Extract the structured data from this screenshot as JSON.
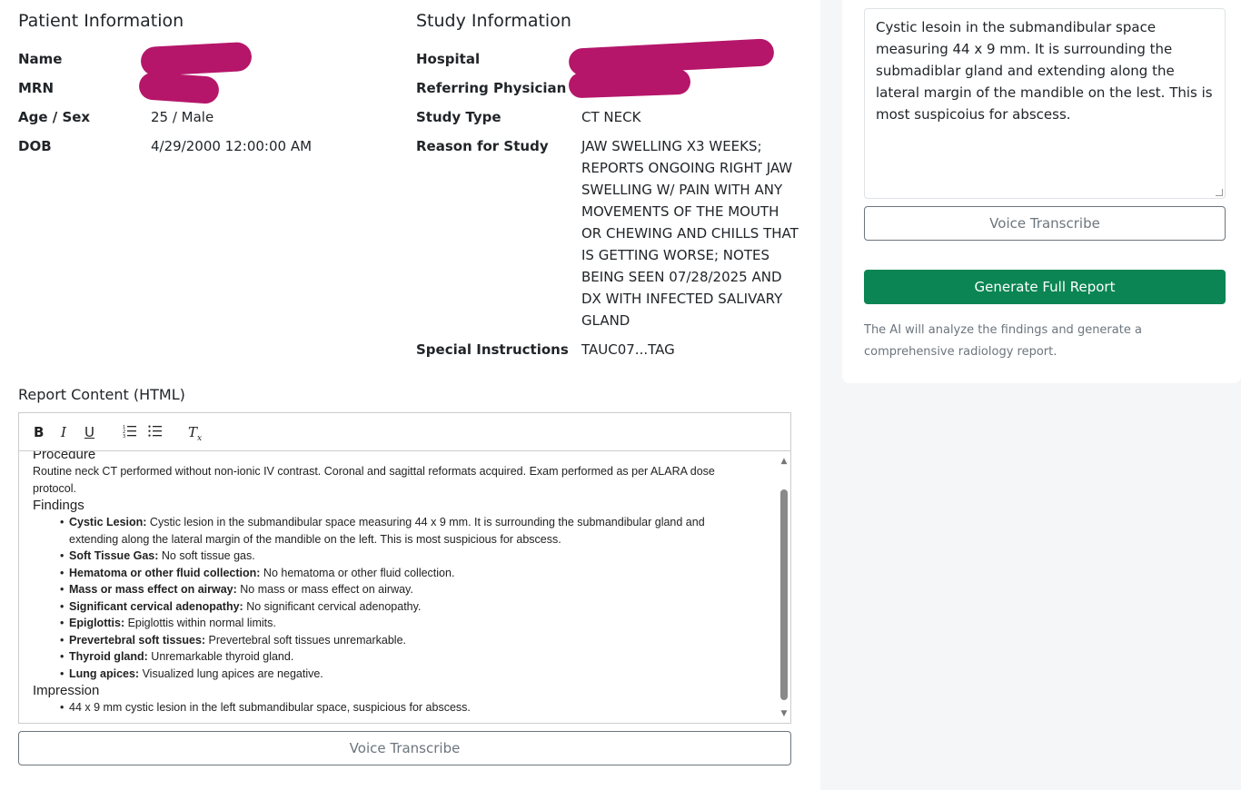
{
  "patient": {
    "title": "Patient Information",
    "name_label": "Name",
    "mrn_label": "MRN",
    "age_sex_label": "Age / Sex",
    "age_sex_value": "25 / Male",
    "dob_label": "DOB",
    "dob_value": "4/29/2000 12:00:00 AM"
  },
  "study": {
    "title": "Study Information",
    "hospital_label": "Hospital",
    "referring_label": "Referring Physician",
    "type_label": "Study Type",
    "type_value": "CT NECK",
    "reason_label": "Reason for Study",
    "reason_lines": [
      "JAW SWELLING X3 WEEKS;",
      "REPORTS ONGOING RIGHT JAW",
      "SWELLING W/ PAIN WITH ANY",
      "MOVEMENTS OF THE MOUTH",
      "OR CHEWING AND CHILLS THAT",
      "IS GETTING WORSE; NOTES",
      "BEING SEEN 07/28/2025 AND",
      "DX WITH INFECTED SALIVARY",
      "GLAND"
    ],
    "special_label": "Special Instructions",
    "special_value": "TAUC07...TAG"
  },
  "report": {
    "label": "Report Content (HTML)",
    "toolbar": {
      "bold": "B",
      "italic": "I",
      "underline": "U",
      "ordered_list": "☰",
      "bullet_list": "☰",
      "clear_format": "Tx"
    },
    "procedure_heading": "Procedure",
    "procedure_text_1": "Routine neck CT performed without non-ionic IV contrast. Coronal and sagittal reformats acquired. Exam performed as per ALARA dose",
    "procedure_text_2": "protocol.",
    "findings_heading": "Findings",
    "findings": [
      {
        "term": "Cystic Lesion:",
        "text": " Cystic lesion in the submandibular space measuring 44 x 9 mm. It is surrounding the submandibular gland and extending along the lateral margin of the mandible on the left. This is most suspicious for abscess."
      },
      {
        "term": "Soft Tissue Gas:",
        "text": " No soft tissue gas."
      },
      {
        "term": "Hematoma or other fluid collection:",
        "text": " No hematoma or other fluid collection."
      },
      {
        "term": "Mass or mass effect on airway:",
        "text": " No mass or mass effect on airway."
      },
      {
        "term": "Significant cervical adenopathy:",
        "text": " No significant cervical adenopathy."
      },
      {
        "term": "Epiglottis:",
        "text": " Epiglottis within normal limits."
      },
      {
        "term": "Prevertebral soft tissues:",
        "text": " Prevertebral soft tissues unremarkable."
      },
      {
        "term": "Thyroid gland:",
        "text": " Unremarkable thyroid gland."
      },
      {
        "term": "Lung apices:",
        "text": " Visualized lung apices are negative."
      }
    ],
    "impression_heading": "Impression",
    "impression": [
      "44 x 9 mm cystic lesion in the left submandibular space, suspicious for abscess."
    ],
    "voice_button": "Voice Transcribe"
  },
  "sidebar": {
    "findings_text": "Cystic lesoin in the submandibular space measuring 44 x 9 mm. It is surrounding the submadiblar gland and extending along the lateral margin of the mandible on the lest. This is most suspicoius for abscess.",
    "voice_button": "Voice Transcribe",
    "generate_button": "Generate Full Report",
    "hint": "The AI will analyze the findings and generate a comprehensive radiology report."
  },
  "colors": {
    "redaction": "#b5166a",
    "primary_green": "#0a8553",
    "muted": "#6c757d"
  }
}
